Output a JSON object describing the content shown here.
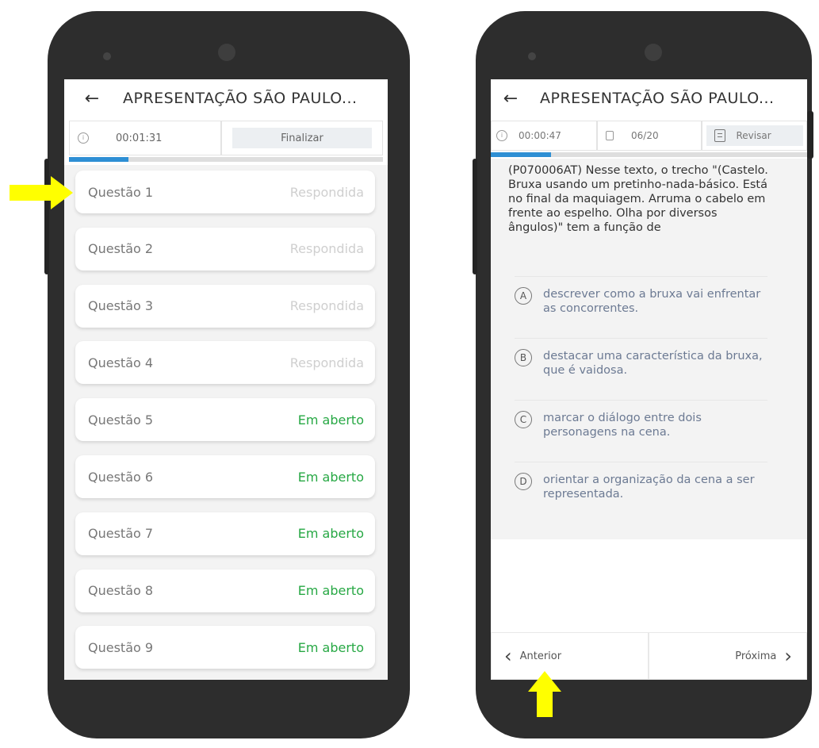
{
  "left": {
    "title": "APRESENTAÇÃO SÃO PAULO...",
    "back_icon": "←",
    "timer_icon": "clock-icon",
    "timer": "00:01:31",
    "finish_label": "Finalizar",
    "progress": 0.19,
    "questions": [
      {
        "name": "Questão 1",
        "status": "Respondida"
      },
      {
        "name": "Questão 2",
        "status": "Respondida"
      },
      {
        "name": "Questão 3",
        "status": "Respondida"
      },
      {
        "name": "Questão 4",
        "status": "Respondida"
      },
      {
        "name": "Questão 5",
        "status": "Em aberto"
      },
      {
        "name": "Questão 6",
        "status": "Em aberto"
      },
      {
        "name": "Questão 7",
        "status": "Em aberto"
      },
      {
        "name": "Questão 8",
        "status": "Em aberto"
      },
      {
        "name": "Questão 9",
        "status": "Em aberto"
      }
    ]
  },
  "right": {
    "title": "APRESENTAÇÃO SÃO PAULO...",
    "back_icon": "←",
    "timer": "00:00:47",
    "page": "06/20",
    "review_label": "Revisar",
    "progress": 0.19,
    "question_text": "(P070006AT) Nesse texto, o trecho \"(Castelo. Bruxa usando um pretinho-nada-básico. Está no final da maquiagem. Arruma o cabelo em frente ao espelho. Olha por diversos ângulos)\" tem a função de",
    "options": [
      {
        "letter": "A",
        "text": "descrever como a bruxa vai enfrentar as concorrentes."
      },
      {
        "letter": "B",
        "text": "destacar uma característica da bruxa, que é vaidosa."
      },
      {
        "letter": "C",
        "text": "marcar o diálogo entre dois personagens na cena."
      },
      {
        "letter": "D",
        "text": "orientar a organização da cena a ser representada."
      }
    ],
    "prev_label": "Anterior",
    "next_label": "Próxima",
    "prev_icon": "‹",
    "next_icon": "›"
  },
  "colors": {
    "accent": "#2e8fd4",
    "open_status": "#27a844",
    "answered_status": "#cfcfcf",
    "indicator_arrow": "#ffff00"
  }
}
